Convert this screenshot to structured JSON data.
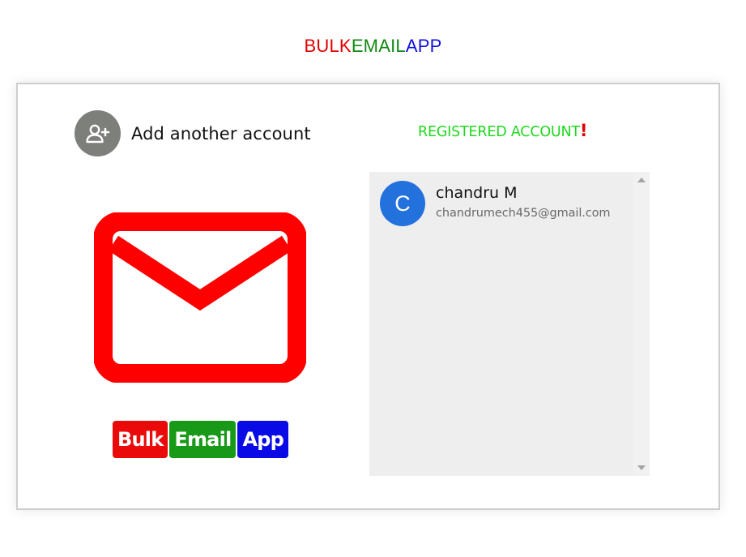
{
  "header": {
    "title_parts": [
      {
        "text": "BULK",
        "color": "#e00000"
      },
      {
        "text": "EMAIL",
        "color": "#118811"
      },
      {
        "text": "APP",
        "color": "#1010e0"
      }
    ]
  },
  "left_panel": {
    "add_account_label": "Add another account",
    "add_account_icon": "person-add-icon",
    "mail_icon": "envelope-icon",
    "mail_icon_color": "#ff0000",
    "brand_badges": [
      {
        "text": "Bulk",
        "bg": "#ea0a0a"
      },
      {
        "text": "Email",
        "bg": "#189a18"
      },
      {
        "text": "App",
        "bg": "#0a0ae6"
      }
    ]
  },
  "right_panel": {
    "heading": "REGISTERED ACCOUNT",
    "heading_mark": "!",
    "heading_color": "#1ed81e",
    "accounts": [
      {
        "initial": "C",
        "name": "chandru M",
        "email": "chandrumech455@gmail.com",
        "avatar_color": "#2371dd"
      }
    ]
  }
}
